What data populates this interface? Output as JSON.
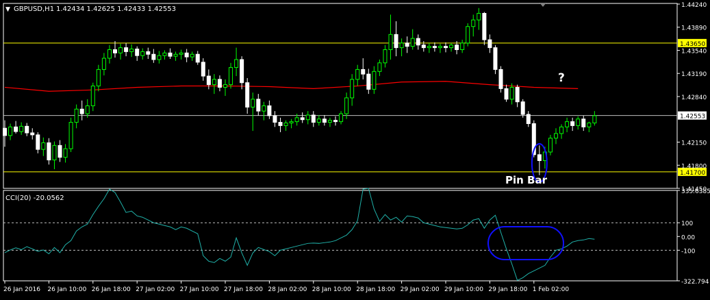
{
  "header": {
    "symbol_label": "GBPUSD,H1",
    "ohlc_label": "1.42434 1.42625 1.42433 1.42553"
  },
  "annotations": {
    "question": "?",
    "pin_bar": "Pin Bar"
  },
  "colors": {
    "background": "#000000",
    "frame": "#ffffff",
    "bull_candle": "#00ff00",
    "bear_candle": "#ffffff",
    "moving_average": "#ff0000",
    "horizontal_level": "#ffff00",
    "current_price_line": "#c0c0c0",
    "cci_line": "#20b2aa",
    "level_dashed": "#c0c0c0",
    "ellipse": "#1010ff",
    "price_label_bg": "#ffff00"
  },
  "chart_data": [
    {
      "type": "candlestick",
      "title": "GBPUSD,H1",
      "ylim": [
        1.4145,
        1.4425
      ],
      "y_ticks": [
        "1.44240",
        "1.43890",
        "1.43540",
        "1.43190",
        "1.42840",
        "1.42150",
        "1.41800",
        "1.41450"
      ],
      "current_price_label": "1.42553",
      "current_price": 1.42553,
      "horizontal_levels": [
        {
          "label": "1.43650",
          "value": 1.4365
        },
        {
          "label": "1.41700",
          "value": 1.417
        }
      ],
      "x_tick_labels": [
        "26 Jan 2016",
        "26 Jan 10:00",
        "26 Jan 18:00",
        "27 Jan 02:00",
        "27 Jan 10:00",
        "27 Jan 18:00",
        "28 Jan 02:00",
        "28 Jan 10:00",
        "28 Jan 18:00",
        "29 Jan 02:00",
        "29 Jan 10:00",
        "29 Jan 18:00",
        "1 Feb 02:00"
      ],
      "bars_per_tick": 8,
      "ohlc": [
        [
          1.4236,
          1.4248,
          1.4208,
          1.4225
        ],
        [
          1.4225,
          1.4243,
          1.4218,
          1.4238
        ],
        [
          1.4238,
          1.4247,
          1.4228,
          1.4231
        ],
        [
          1.4231,
          1.4245,
          1.4226,
          1.4239
        ],
        [
          1.4239,
          1.4244,
          1.4224,
          1.4229
        ],
        [
          1.4229,
          1.4236,
          1.4219,
          1.4226
        ],
        [
          1.4226,
          1.423,
          1.4198,
          1.4204
        ],
        [
          1.4204,
          1.4222,
          1.4194,
          1.4214
        ],
        [
          1.4214,
          1.4221,
          1.4181,
          1.4188
        ],
        [
          1.4188,
          1.4216,
          1.4174,
          1.421
        ],
        [
          1.421,
          1.4218,
          1.4185,
          1.4192
        ],
        [
          1.4192,
          1.4212,
          1.4184,
          1.4205
        ],
        [
          1.4205,
          1.4252,
          1.42,
          1.4245
        ],
        [
          1.4245,
          1.4272,
          1.4236,
          1.4265
        ],
        [
          1.4265,
          1.4278,
          1.4248,
          1.4258
        ],
        [
          1.4258,
          1.428,
          1.4252,
          1.427
        ],
        [
          1.427,
          1.4305,
          1.4262,
          1.43
        ],
        [
          1.43,
          1.4332,
          1.4292,
          1.4325
        ],
        [
          1.4325,
          1.435,
          1.4316,
          1.4342
        ],
        [
          1.4342,
          1.4362,
          1.4334,
          1.4355
        ],
        [
          1.4355,
          1.4368,
          1.4343,
          1.435
        ],
        [
          1.435,
          1.4364,
          1.434,
          1.4358
        ],
        [
          1.4358,
          1.4365,
          1.4345,
          1.4352
        ],
        [
          1.4352,
          1.4363,
          1.4344,
          1.4356
        ],
        [
          1.4356,
          1.436,
          1.4338,
          1.4346
        ],
        [
          1.4346,
          1.4357,
          1.434,
          1.4352
        ],
        [
          1.4352,
          1.4358,
          1.4341,
          1.4348
        ],
        [
          1.4348,
          1.4356,
          1.4335,
          1.434
        ],
        [
          1.434,
          1.4353,
          1.4334,
          1.4346
        ],
        [
          1.4346,
          1.4354,
          1.434,
          1.435
        ],
        [
          1.435,
          1.4357,
          1.4341,
          1.4345
        ],
        [
          1.4345,
          1.4352,
          1.4338,
          1.4348
        ],
        [
          1.4348,
          1.4355,
          1.434,
          1.435
        ],
        [
          1.435,
          1.4356,
          1.4336,
          1.4344
        ],
        [
          1.4344,
          1.4352,
          1.4338,
          1.4348
        ],
        [
          1.4348,
          1.4353,
          1.4332,
          1.4336
        ],
        [
          1.4336,
          1.4342,
          1.4308,
          1.4315
        ],
        [
          1.4315,
          1.4325,
          1.4295,
          1.4302
        ],
        [
          1.4302,
          1.4318,
          1.4288,
          1.431
        ],
        [
          1.431,
          1.4316,
          1.4292,
          1.4298
        ],
        [
          1.4298,
          1.431,
          1.4285,
          1.4302
        ],
        [
          1.4302,
          1.4335,
          1.4296,
          1.4328
        ],
        [
          1.4328,
          1.4358,
          1.4315,
          1.434
        ],
        [
          1.434,
          1.4345,
          1.4295,
          1.4305
        ],
        [
          1.4305,
          1.4312,
          1.4258,
          1.4268
        ],
        [
          1.4268,
          1.429,
          1.4232,
          1.428
        ],
        [
          1.428,
          1.4288,
          1.4255,
          1.4262
        ],
        [
          1.4262,
          1.4276,
          1.4248,
          1.427
        ],
        [
          1.427,
          1.4278,
          1.425,
          1.4255
        ],
        [
          1.4255,
          1.4262,
          1.4238,
          1.4245
        ],
        [
          1.4245,
          1.4252,
          1.423,
          1.424
        ],
        [
          1.424,
          1.4248,
          1.4232,
          1.4244
        ],
        [
          1.4244,
          1.425,
          1.4236,
          1.4246
        ],
        [
          1.4246,
          1.4258,
          1.424,
          1.4252
        ],
        [
          1.4252,
          1.426,
          1.4244,
          1.4249
        ],
        [
          1.4249,
          1.4262,
          1.4242,
          1.4256
        ],
        [
          1.4256,
          1.4262,
          1.4238,
          1.4245
        ],
        [
          1.4245,
          1.4256,
          1.424,
          1.425
        ],
        [
          1.425,
          1.4256,
          1.424,
          1.4245
        ],
        [
          1.4245,
          1.4252,
          1.4238,
          1.4248
        ],
        [
          1.4248,
          1.4254,
          1.424,
          1.4246
        ],
        [
          1.4246,
          1.4262,
          1.4242,
          1.4258
        ],
        [
          1.4258,
          1.429,
          1.425,
          1.4282
        ],
        [
          1.4282,
          1.4318,
          1.427,
          1.431
        ],
        [
          1.431,
          1.4332,
          1.43,
          1.4325
        ],
        [
          1.4325,
          1.4342,
          1.431,
          1.4318
        ],
        [
          1.4318,
          1.4326,
          1.4288,
          1.4295
        ],
        [
          1.4295,
          1.433,
          1.4288,
          1.4322
        ],
        [
          1.4322,
          1.434,
          1.4315,
          1.4335
        ],
        [
          1.4335,
          1.4362,
          1.4328,
          1.4355
        ],
        [
          1.4355,
          1.4408,
          1.434,
          1.4378
        ],
        [
          1.4378,
          1.4398,
          1.4345,
          1.4358
        ],
        [
          1.4358,
          1.4372,
          1.4345,
          1.4365
        ],
        [
          1.4365,
          1.4375,
          1.435,
          1.436
        ],
        [
          1.436,
          1.4386,
          1.4355,
          1.4372
        ],
        [
          1.4372,
          1.4378,
          1.4355,
          1.4362
        ],
        [
          1.4362,
          1.4368,
          1.4352,
          1.4358
        ],
        [
          1.4358,
          1.4365,
          1.435,
          1.436
        ],
        [
          1.436,
          1.4366,
          1.4352,
          1.4358
        ],
        [
          1.4358,
          1.4364,
          1.435,
          1.436
        ],
        [
          1.436,
          1.4366,
          1.4351,
          1.4358
        ],
        [
          1.4358,
          1.4365,
          1.4352,
          1.4362
        ],
        [
          1.4362,
          1.4368,
          1.4348,
          1.4355
        ],
        [
          1.4355,
          1.437,
          1.435,
          1.4365
        ],
        [
          1.4365,
          1.4395,
          1.436,
          1.439
        ],
        [
          1.439,
          1.4408,
          1.4375,
          1.44
        ],
        [
          1.44,
          1.4418,
          1.4385,
          1.441
        ],
        [
          1.441,
          1.4412,
          1.4362,
          1.437
        ],
        [
          1.437,
          1.4378,
          1.435,
          1.4358
        ],
        [
          1.4358,
          1.4362,
          1.4318,
          1.4325
        ],
        [
          1.4325,
          1.433,
          1.429,
          1.4296
        ],
        [
          1.4296,
          1.4302,
          1.4276,
          1.428
        ],
        [
          1.428,
          1.4304,
          1.4272,
          1.4298
        ],
        [
          1.4298,
          1.4302,
          1.4268,
          1.4276
        ],
        [
          1.4276,
          1.428,
          1.4252,
          1.4257
        ],
        [
          1.4257,
          1.4262,
          1.4238,
          1.4243
        ],
        [
          1.4243,
          1.4248,
          1.4192,
          1.4196
        ],
        [
          1.4196,
          1.421,
          1.4165,
          1.4187
        ],
        [
          1.4187,
          1.4208,
          1.4175,
          1.42
        ],
        [
          1.42,
          1.4226,
          1.4195,
          1.4221
        ],
        [
          1.4221,
          1.4236,
          1.4212,
          1.4228
        ],
        [
          1.4228,
          1.4242,
          1.422,
          1.4238
        ],
        [
          1.4238,
          1.4252,
          1.423,
          1.4246
        ],
        [
          1.4246,
          1.4252,
          1.4232,
          1.424
        ],
        [
          1.424,
          1.4254,
          1.4234,
          1.425
        ],
        [
          1.425,
          1.4255,
          1.4232,
          1.4238
        ],
        [
          1.4238,
          1.4246,
          1.423,
          1.4244
        ],
        [
          1.4244,
          1.4262,
          1.424,
          1.4255
        ]
      ],
      "moving_average": {
        "color": "#ff0000",
        "start": 1.43,
        "values_at_ticks": [
          1.4298,
          1.4292,
          1.4294,
          1.4298,
          1.43,
          1.43,
          1.4299,
          1.4296,
          1.43,
          1.4306,
          1.4307,
          1.4302,
          1.4298,
          1.4296
        ]
      },
      "pin_bar_index": 97
    },
    {
      "type": "line",
      "title": "CCI(20) -20.0562",
      "ylim": [
        -322.794,
        335.6385
      ],
      "y_ticks": [
        "335.6385",
        "100",
        "0.00",
        "-100",
        "-322.794"
      ],
      "levels": [
        100,
        -100
      ],
      "values": [
        -118,
        -98,
        -82,
        -96,
        -74,
        -90,
        -108,
        -98,
        -126,
        -80,
        -118,
        -60,
        -30,
        40,
        70,
        90,
        160,
        220,
        275,
        345,
        320,
        250,
        175,
        185,
        150,
        140,
        120,
        100,
        90,
        80,
        70,
        50,
        70,
        60,
        40,
        20,
        -140,
        -180,
        -190,
        -160,
        -180,
        -150,
        -10,
        -120,
        -210,
        -120,
        -80,
        -95,
        -110,
        -140,
        -100,
        -90,
        -80,
        -70,
        -60,
        -50,
        -48,
        -50,
        -45,
        -40,
        -30,
        -10,
        10,
        50,
        115,
        345,
        350,
        200,
        110,
        160,
        120,
        140,
        105,
        150,
        145,
        135,
        100,
        90,
        80,
        70,
        65,
        60,
        55,
        60,
        85,
        120,
        130,
        60,
        120,
        155,
        30,
        -90,
        -200,
        -320,
        -300,
        -270,
        -250,
        -230,
        -210,
        -150,
        -100,
        -90,
        -70,
        -40,
        -30,
        -25,
        -15,
        -20
      ]
    }
  ]
}
